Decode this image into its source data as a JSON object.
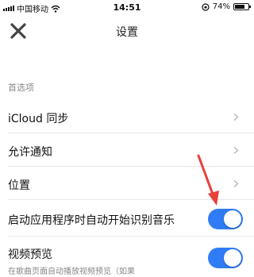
{
  "status_bar": {
    "carrier": "中国移动",
    "time": "14:51",
    "battery_text": "74%",
    "battery_level": 0.74
  },
  "nav": {
    "title": "设置",
    "close_icon": "close-icon"
  },
  "section": {
    "header": "首选项"
  },
  "rows": [
    {
      "label": "iCloud 同步",
      "type": "link"
    },
    {
      "label": "允许通知",
      "type": "link"
    },
    {
      "label": "位置",
      "type": "link"
    },
    {
      "label": "启动应用程序时自动开始识别音乐",
      "type": "toggle",
      "on": true
    },
    {
      "label": "视频预览",
      "type": "toggle",
      "on": true,
      "subtitle": "在歌曲页面自动播放视频预览（如果"
    }
  ],
  "colors": {
    "toggle_on": "#2f7cf6",
    "annotation_arrow": "#e8413b"
  }
}
